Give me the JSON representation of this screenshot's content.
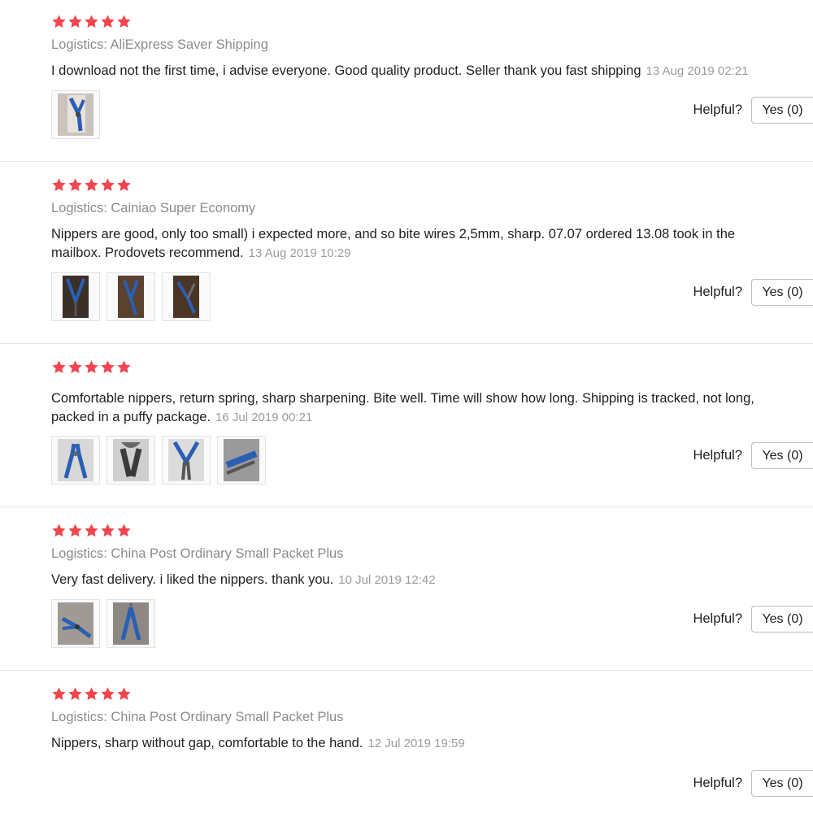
{
  "colors": {
    "star": "#f0464f",
    "logistics_text": "#8c8c8c",
    "date_text": "#9b9b9b",
    "divider": "#e6e6e6"
  },
  "reviews": [
    {
      "rating": 5,
      "logistics": "Logistics: AliExpress Saver Shipping",
      "text": "I download not the first time, i advise everyone. Good quality product. Seller thank you fast shipping",
      "date": "13 Aug 2019 02:21",
      "photo_count": 1,
      "helpful_label": "Helpful?",
      "yes_label": "Yes (0)"
    },
    {
      "rating": 5,
      "logistics": "Logistics: Cainiao Super Economy",
      "text": "Nippers are good, only too small) i expected more, and so bite wires 2,5mm, sharp. 07.07 ordered 13.08 took in the mailbox. Prodovets recommend.",
      "date": "13 Aug 2019 10:29",
      "photo_count": 3,
      "helpful_label": "Helpful?",
      "yes_label": "Yes (0)"
    },
    {
      "rating": 5,
      "logistics": "",
      "text": "Comfortable nippers, return spring, sharp sharpening. Bite well. Time will show how long. Shipping is tracked, not long, packed in a puffy package.",
      "date": "16 Jul 2019 00:21",
      "photo_count": 4,
      "helpful_label": "Helpful?",
      "yes_label": "Yes (0)"
    },
    {
      "rating": 5,
      "logistics": "Logistics: China Post Ordinary Small Packet Plus",
      "text": "Very fast delivery. i liked the nippers. thank you.",
      "date": "10 Jul 2019 12:42",
      "photo_count": 2,
      "helpful_label": "Helpful?",
      "yes_label": "Yes (0)"
    },
    {
      "rating": 5,
      "logistics": "Logistics: China Post Ordinary Small Packet Plus",
      "text": "Nippers, sharp without gap, comfortable to the hand.",
      "date": "12 Jul 2019 19:59",
      "photo_count": 0,
      "helpful_label": "Helpful?",
      "yes_label": "Yes (0)"
    }
  ]
}
